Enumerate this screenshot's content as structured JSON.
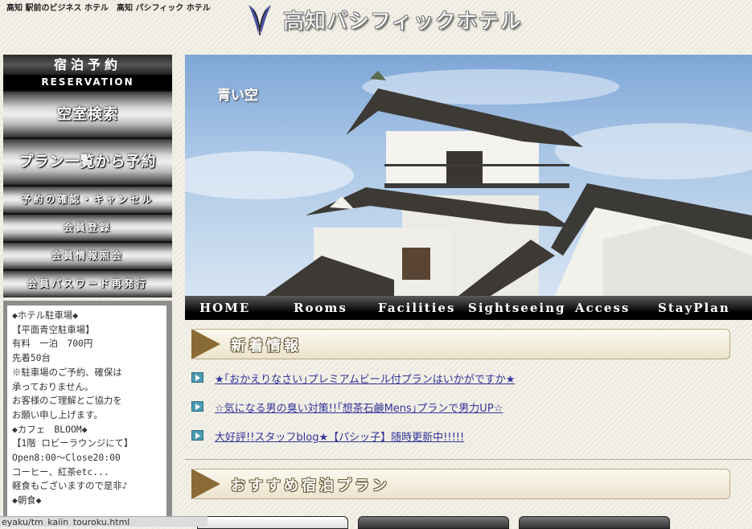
{
  "header": {
    "tagline": "高知 駅前のビジネス ホテル　高知 パシフィック ホテル",
    "brand": "高知パシフィックホテル"
  },
  "sidebar": {
    "reservation_title": "宿泊予約",
    "reservation_sub": "RESERVATION",
    "buttons": [
      "空室検索",
      "プラン一覧から予約",
      "予約の確認・キャンセル",
      "会員登録",
      "会員情報照会",
      "会員パスワード再発行"
    ]
  },
  "parking": {
    "lines": [
      "◆ホテル駐車場◆",
      "【平面青空駐車場】",
      "有料　一泊　700円",
      "先着50台",
      "※駐車場のご予約、確保は",
      "承っておりません。",
      "お客様のご理解とご協力を",
      "お願い申し上げます。",
      "◆カフェ　BLOOM◆",
      "【1階 ロビーラウンジにて】",
      "Open8:00～Close20:00",
      "コーヒー、紅茶etc...",
      "軽食もございますので是非♪",
      "◆朝食◆"
    ]
  },
  "hero": {
    "caption": "青い空"
  },
  "nav": [
    "HOME",
    "Rooms",
    "Facilities",
    "Sightseeing",
    "Access",
    "StayPlan"
  ],
  "news": {
    "title": "新着情報",
    "items": [
      "★｢おかえりなさい｣プレミアムビール付プランはいかがですか★",
      "☆気になる男の臭い対策!!｢想茶石鹸Mens｣プランで男力UP☆",
      "大好評!!スタッフblog★【パシッ子】随時更新中!!!!!"
    ]
  },
  "plans": {
    "title": "おすすめ宿泊プラン"
  },
  "statusbar": {
    "url": "eyaku/tm_kaiin_touroku.html"
  },
  "colors": {
    "link": "#33339a",
    "accent": "#8a6a35",
    "sky": "#7ea6d6"
  }
}
